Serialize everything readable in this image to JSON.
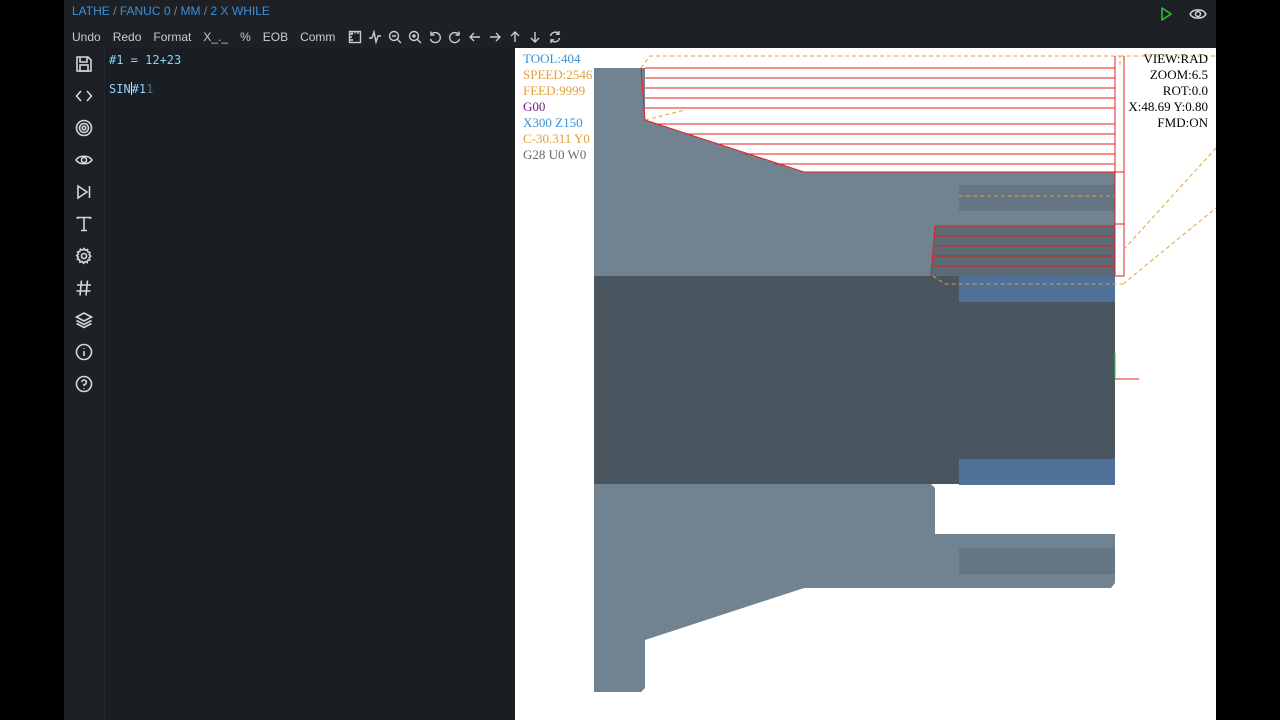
{
  "breadcrumb": {
    "machine": "LATHE",
    "control": "FANUC 0",
    "units": "MM",
    "program": "2 X WHILE",
    "separator": " / "
  },
  "top_right": {
    "run_icon": "play-icon",
    "view_icon": "eye-icon"
  },
  "toolbar": {
    "undo": "Undo",
    "redo": "Redo",
    "format": "Format",
    "x_placeholder": "X_._",
    "percent": "%",
    "eob": "EOB",
    "comm": "Comm",
    "icons": [
      "ruler-icon",
      "pulse-icon",
      "zoom-out-icon",
      "zoom-in-icon",
      "rotate-left-icon",
      "rotate-right-icon",
      "arrow-left-icon",
      "arrow-right-icon",
      "arrow-up-icon",
      "arrow-down-icon",
      "refresh-icon"
    ]
  },
  "sidebar": {
    "items": [
      "save-icon",
      "code-icon",
      "target-icon",
      "eye-icon",
      "skip-forward-icon",
      "text-icon",
      "settings-icon",
      "hash-icon",
      "layers-icon",
      "info-icon",
      "help-icon"
    ]
  },
  "editor": {
    "line1": "#1 = 12+23",
    "line2_before": "SIN",
    "line2_after": "#1",
    "line2_ghost": "1"
  },
  "viewport": {
    "status_left": {
      "tool": "TOOL:404",
      "speed": "SPEED:2546",
      "feed": "FEED:9999",
      "gcode": "G00",
      "xz": "X300 Z150",
      "cy": "C-30.311 Y0",
      "g28": "G28 U0 W0"
    },
    "status_right": {
      "view": "VIEW:RAD",
      "zoom": "ZOOM:6.5",
      "rot": "ROT:0.0",
      "xy": "X:48.69 Y:0.80",
      "fmd": "FMD:ON"
    },
    "colors": {
      "tool": "#3b8fd0",
      "speed": "#e0a03a",
      "feed": "#e0a03a",
      "gcode": "#7a1a80",
      "xz": "#3b8fd0",
      "cy": "#e0a03a",
      "g28": "#6a6a6a",
      "toolpath": "#e02020",
      "rapid": "#e0a03a",
      "stock": "#708090"
    }
  }
}
